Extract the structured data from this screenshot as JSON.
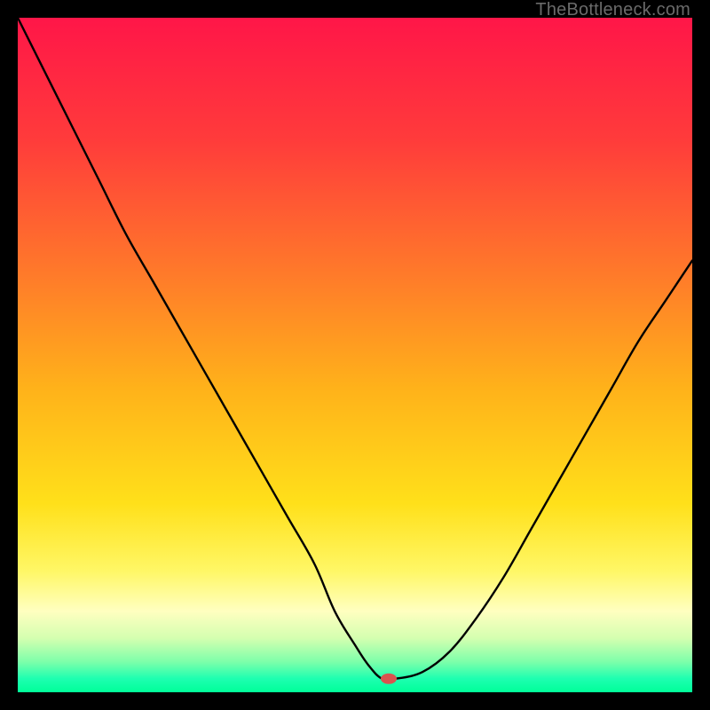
{
  "watermark": "TheBottleneck.com",
  "chart_data": {
    "type": "line",
    "title": "",
    "xlabel": "",
    "ylabel": "",
    "xlim": [
      0,
      100
    ],
    "ylim": [
      0,
      100
    ],
    "background_gradient": {
      "stops": [
        {
          "offset": 0.0,
          "color": "#ff1648"
        },
        {
          "offset": 0.18,
          "color": "#ff3b3b"
        },
        {
          "offset": 0.38,
          "color": "#ff7a2a"
        },
        {
          "offset": 0.55,
          "color": "#ffb21a"
        },
        {
          "offset": 0.72,
          "color": "#ffe01a"
        },
        {
          "offset": 0.82,
          "color": "#fff766"
        },
        {
          "offset": 0.88,
          "color": "#ffffc0"
        },
        {
          "offset": 0.92,
          "color": "#d4ffb0"
        },
        {
          "offset": 0.955,
          "color": "#7dffaa"
        },
        {
          "offset": 0.98,
          "color": "#1dffb0"
        },
        {
          "offset": 1.0,
          "color": "#00ff99"
        }
      ]
    },
    "series": [
      {
        "name": "bottleneck-curve",
        "color": "#000000",
        "width": 2.4,
        "x": [
          0,
          4,
          8,
          12,
          16,
          20,
          24,
          28,
          32,
          36,
          40,
          44,
          47,
          50,
          52,
          54,
          56,
          60,
          64,
          68,
          72,
          76,
          80,
          84,
          88,
          92,
          96,
          100
        ],
        "y": [
          100,
          92,
          84,
          76,
          68,
          61,
          54,
          47,
          40,
          33,
          26,
          19,
          12,
          7,
          4,
          2,
          2,
          3,
          6,
          11,
          17,
          24,
          31,
          38,
          45,
          52,
          58,
          64
        ]
      }
    ],
    "markers": [
      {
        "name": "optimal-point",
        "x": 55,
        "y": 2,
        "color": "#d9534f",
        "rx": 9,
        "ry": 6
      }
    ]
  }
}
